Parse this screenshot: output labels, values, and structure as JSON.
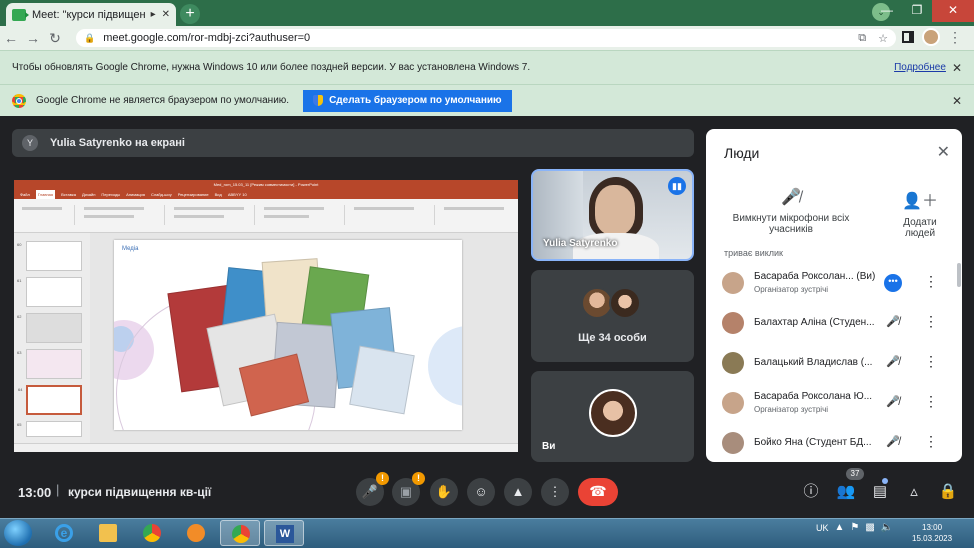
{
  "browser": {
    "tab_title": "Meet: \"курси підвищення к",
    "tab_icons": [
      "speaker-icon",
      "close-icon"
    ],
    "new_tab_label": "+",
    "url": "meet.google.com/ror-mdbj-zci?authuser=0"
  },
  "infobar_update": {
    "text": "Чтобы обновлять Google Chrome, нужна Windows 10 или более поздней версии. У вас установлена Windows 7.",
    "link": "Подробнее"
  },
  "infobar_default": {
    "text": "Google Chrome не является браузером по умолчанию.",
    "button": "Сделать браузером по умолчанию"
  },
  "meet": {
    "presenter_initial": "Y",
    "presenter_banner": "Yulia Satyrenko на екрані",
    "tiles": {
      "speaker_name": "Yulia Satyrenko",
      "others_label": "Ще 34 особи",
      "self_label": "Ви"
    },
    "people_panel": {
      "title": "Люди",
      "mute_all": "Вимкнути мікрофони всіх учасників",
      "add_people": "Додати людей",
      "section_label": "триває виклик",
      "participants": [
        {
          "name": "Басараба Роксолан... (Ви)",
          "role": "Організатор зустрічі",
          "color": "#c7a48a"
        },
        {
          "name": "Балахтар Аліна (Студен...",
          "role": "",
          "color": "#b5826a"
        },
        {
          "name": "Балацький Владислав (...",
          "role": "",
          "color": "#8a7a55"
        },
        {
          "name": "Басараба Роксолана Ю...",
          "role": "Організатор зустрічі",
          "color": "#c7a48a"
        },
        {
          "name": "Бойко Яна (Студент БД...",
          "role": "",
          "color": "#a88d7c"
        }
      ]
    },
    "bottom": {
      "time": "13:00",
      "separator": "|",
      "meeting_name": "курси підвищення кв-ції",
      "participant_count": "37"
    },
    "slide": {
      "window_title": "Med_rom_15.03_11 [Режим совместимости] - PowerPoint",
      "ribbon_tabs": [
        "Файл",
        "Главная",
        "Вставка",
        "Дизайн",
        "Переходы",
        "Анимация",
        "Слайд-шоу",
        "Рецензирование",
        "Вид",
        "ABBYY 10"
      ],
      "slide_title": "Медіа",
      "thumb_numbers": [
        "60",
        "61",
        "62",
        "63",
        "64",
        "65"
      ]
    }
  },
  "taskbar": {
    "lang": "UK",
    "time": "13:00",
    "date": "15.03.2023"
  },
  "colors": {
    "chrome_frame": "#2d6e49",
    "infobar": "#d3e8d8",
    "meet_bg": "#202124",
    "accent_blue": "#1a73e8",
    "hangup_red": "#ea4335",
    "warning": "#f29900"
  }
}
